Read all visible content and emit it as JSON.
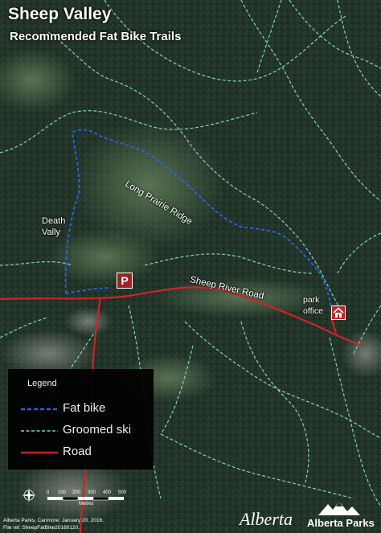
{
  "title": "Sheep Valley",
  "subtitle": "Recommended Fat Bike Trails",
  "places": {
    "death_valley": "Death\nVally",
    "long_prairie_ridge": "Long Prairie Ridge",
    "sheep_river_road": "Sheep River Road",
    "park_office": "park\noffice"
  },
  "parking_label": "P",
  "legend": {
    "title": "Legend",
    "items": [
      {
        "label": "Fat bike",
        "color": "#2b66e8",
        "style": "dashed"
      },
      {
        "label": "Groomed ski",
        "color": "#7fe0cf",
        "style": "dashed"
      },
      {
        "label": "Road",
        "color": "#d0222a",
        "style": "solid"
      }
    ]
  },
  "scale": {
    "ticks": [
      "0",
      "100",
      "200",
      "300",
      "400",
      "500"
    ],
    "unit": "Metres"
  },
  "footer": {
    "line1": "Alberta Parks, Canmore: January 20, 2016.",
    "line2": "File ref: SheepFatBike20160120."
  },
  "brand": {
    "alberta": "Alberta",
    "alberta_parks": "Alberta Parks"
  },
  "colors": {
    "fat_bike": "#2b66e8",
    "groomed_ski": "#7fe0cf",
    "road": "#d0222a",
    "parking": "#a21f22",
    "park_office_icon": "#c0262b"
  },
  "icons": {
    "north_arrow": "compass-icon",
    "parking": "parking-icon",
    "park_office": "house-icon",
    "parks_logo": "mountain-icon"
  }
}
